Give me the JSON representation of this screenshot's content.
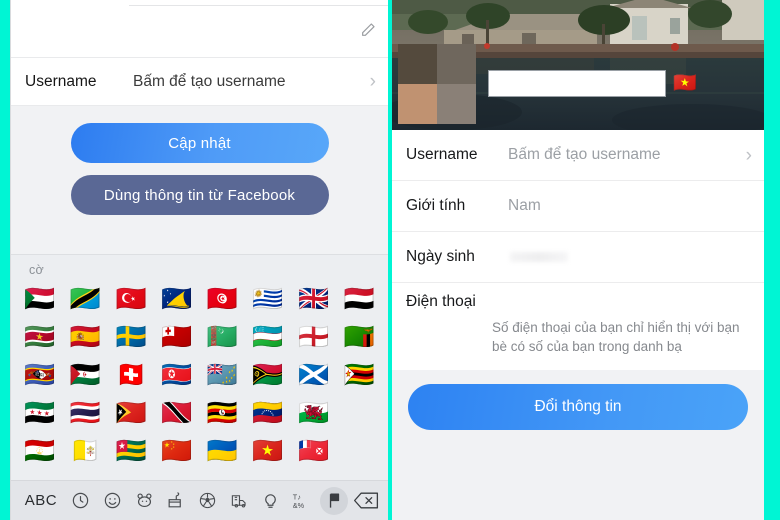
{
  "theme": {
    "frame_color": "#00f5d4",
    "primary_button_color": "#3b8ff4",
    "secondary_button_color": "#5a6895",
    "panel_bg": "#f1f2f4",
    "card_bg": "#ffffff",
    "label_color": "#17181a",
    "muted_text_color": "#9ca0a5"
  },
  "left_panel": {
    "edit_icon": "pencil-icon",
    "username_row": {
      "label": "Username",
      "value": "Bấm để tạo username",
      "chevron": "›"
    },
    "buttons": {
      "primary": "Cập nhật",
      "secondary": "Dùng thông tin từ Facebook"
    }
  },
  "keyboard": {
    "category_label": "cờ",
    "flags": [
      "🇸🇩",
      "🇹🇿",
      "🇹🇷",
      "🇹🇰",
      "🇹🇳",
      "🇺🇾",
      "🇬🇧",
      "🇾🇪",
      "🇸🇷",
      "🇪🇸",
      "🇸🇪",
      "🇹🇴",
      "🇹🇲",
      "🇺🇿",
      "🏴󠁧󠁢󠁥󠁮󠁧󠁿",
      "🇿🇲",
      "🇸🇿",
      "🇪🇭",
      "🇨🇭",
      "🇰🇵",
      "🇹🇻",
      "🇻🇺",
      "🏴󠁧󠁢󠁳󠁣󠁴󠁿",
      "🇿🇼",
      "🇸🇾",
      "🇹🇭",
      "🇹🇱",
      "🇹🇹",
      "🇺🇬",
      "🇻🇪",
      "🏴󠁧󠁢󠁷󠁬󠁳󠁿",
      "",
      "🇹🇯",
      "🇻🇦",
      "🇹🇬",
      "🇨🇳",
      "🇺🇦",
      "🇻🇳",
      "🇼🇫",
      ""
    ],
    "toolbar": [
      {
        "name": "abc-key",
        "label": "ABC",
        "selected": false
      },
      {
        "name": "recent-clock-icon",
        "label": "",
        "selected": false
      },
      {
        "name": "smiley-icon",
        "label": "",
        "selected": false
      },
      {
        "name": "animals-panda-icon",
        "label": "",
        "selected": false
      },
      {
        "name": "food-icon",
        "label": "",
        "selected": false
      },
      {
        "name": "sports-soccer-icon",
        "label": "",
        "selected": false
      },
      {
        "name": "travel-car-icon",
        "label": "",
        "selected": false
      },
      {
        "name": "objects-bulb-icon",
        "label": "",
        "selected": false
      },
      {
        "name": "symbols-icon",
        "label": "",
        "selected": false
      },
      {
        "name": "flags-icon",
        "label": "",
        "selected": true
      },
      {
        "name": "backspace-icon",
        "label": "",
        "selected": false
      }
    ]
  },
  "right_panel": {
    "cover_photo_alt": "rural village by a lake",
    "avatar": "blurred-avatar",
    "name_input_value": "",
    "name_input_placeholder": "",
    "cover_flag": "🇻🇳",
    "rows": [
      {
        "label": "Username",
        "value": "Bấm để tạo username",
        "chevron": "›",
        "blurred": false
      },
      {
        "label": "Giới tính",
        "value": "Nam",
        "chevron": "",
        "blurred": false
      },
      {
        "label": "Ngày sinh",
        "value": "",
        "chevron": "",
        "blurred": true
      }
    ],
    "phone": {
      "label": "Điện thoại",
      "note": "Số điện thoại của bạn chỉ hiển thị với bạn bè có số của bạn trong danh bạ"
    },
    "cta_label": "Đổi thông tin"
  }
}
